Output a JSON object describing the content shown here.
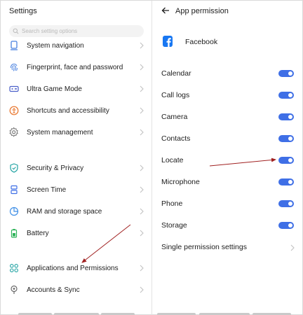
{
  "left": {
    "title": "Settings",
    "search_placeholder": "Search setting options",
    "items": [
      {
        "label": "System navigation",
        "icon": "navigation-icon"
      },
      {
        "label": "Fingerprint, face and password",
        "icon": "fingerprint-icon"
      },
      {
        "label": "Ultra Game Mode",
        "icon": "game-icon"
      },
      {
        "label": "Shortcuts and accessibility",
        "icon": "accessibility-icon"
      },
      {
        "label": "System management",
        "icon": "gear-icon"
      },
      {
        "label": "Security & Privacy",
        "icon": "shield-icon"
      },
      {
        "label": "Screen Time",
        "icon": "hourglass-icon"
      },
      {
        "label": "RAM and storage space",
        "icon": "pie-chart-icon"
      },
      {
        "label": "Battery",
        "icon": "battery-icon"
      },
      {
        "label": "Applications and Permissions",
        "icon": "apps-grid-icon"
      },
      {
        "label": "Accounts & Sync",
        "icon": "account-icon"
      }
    ]
  },
  "right": {
    "title": "App permission",
    "app_name": "Facebook",
    "permissions": [
      {
        "label": "Calendar",
        "enabled": true
      },
      {
        "label": "Call logs",
        "enabled": true
      },
      {
        "label": "Camera",
        "enabled": true
      },
      {
        "label": "Contacts",
        "enabled": true
      },
      {
        "label": "Locate",
        "enabled": true
      },
      {
        "label": "Microphone",
        "enabled": true
      },
      {
        "label": "Phone",
        "enabled": true
      },
      {
        "label": "Storage",
        "enabled": true
      }
    ],
    "single_permission_settings": "Single permission settings"
  },
  "colors": {
    "accent": "#3f6fe6",
    "annotation_arrow": "#a02020",
    "facebook_blue": "#1877f2",
    "orange": "#e8742a"
  }
}
